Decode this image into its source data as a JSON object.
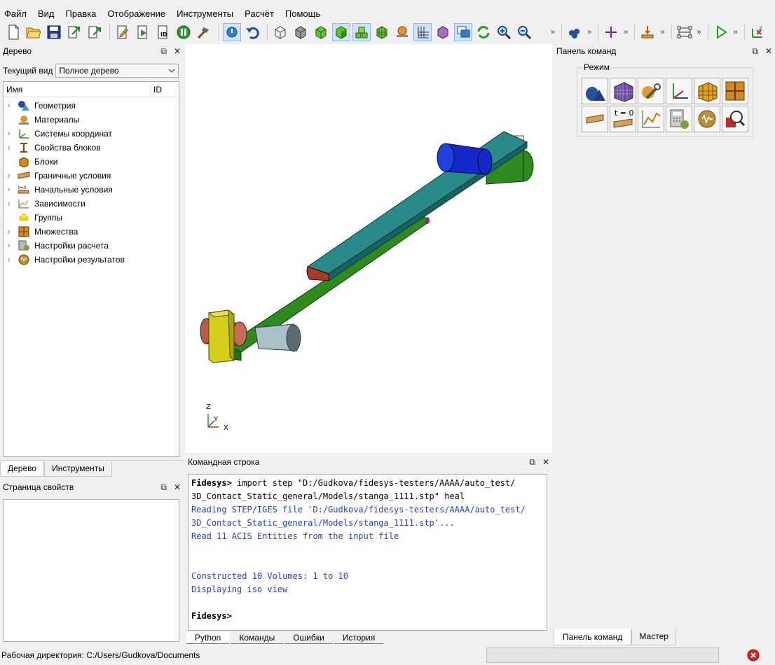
{
  "menu": [
    "Файл",
    "Вид",
    "Правка",
    "Отображение",
    "Инструменты",
    "Расчёт",
    "Помощь"
  ],
  "toolbar": {
    "more_label": "»"
  },
  "tree_panel": {
    "title": "Дерево",
    "float_icon": "⧉",
    "close_icon": "✕",
    "view_label": "Текущий вид",
    "view_value": "Полное дерево",
    "col_name": "Имя",
    "col_id": "ID",
    "items": [
      {
        "label": "Геометрия",
        "icon": "geometry-icon",
        "expandable": true
      },
      {
        "label": "Материалы",
        "icon": "materials-icon",
        "expandable": false
      },
      {
        "label": "Системы координат",
        "icon": "coordinate-systems-icon",
        "expandable": true
      },
      {
        "label": "Свойства блоков",
        "icon": "block-properties-icon",
        "expandable": true
      },
      {
        "label": "Блоки",
        "icon": "blocks-icon",
        "expandable": false
      },
      {
        "label": "Граничные условия",
        "icon": "boundary-conditions-icon",
        "expandable": true
      },
      {
        "label": "Начальные условия",
        "icon": "initial-conditions-icon",
        "expandable": true
      },
      {
        "label": "Зависимости",
        "icon": "dependencies-icon",
        "expandable": true
      },
      {
        "label": "Группы",
        "icon": "groups-icon",
        "expandable": false
      },
      {
        "label": "Множества",
        "icon": "sets-icon",
        "expandable": true
      },
      {
        "label": "Настройки расчета",
        "icon": "calc-settings-icon",
        "expandable": true
      },
      {
        "label": "Настройки результатов",
        "icon": "result-settings-icon",
        "expandable": true
      }
    ],
    "tabs": [
      "Дерево",
      "Инструменты"
    ]
  },
  "props_panel": {
    "title": "Страница свойств"
  },
  "viewport": {
    "axis_labels": {
      "z": "Z",
      "y": "Y",
      "x": "X"
    }
  },
  "command_panel": {
    "title": "Командная строка",
    "lines": [
      {
        "type": "cmd",
        "prompt": "Fidesys>",
        "text": " import step \"D:/Gudkova/fidesys-testers/AAAA/auto_test/"
      },
      {
        "type": "cmd-cont",
        "prompt": "",
        "text": "3D_Contact_Static_general/Models/stanga_1111.stp\" heal"
      },
      {
        "type": "out",
        "prompt": "",
        "text": "Reading STEP/IGES file 'D:/Gudkova/fidesys-testers/AAAA/auto_test/"
      },
      {
        "type": "out",
        "prompt": "",
        "text": "3D_Contact_Static_general/Models/stanga_1111.stp'..."
      },
      {
        "type": "out",
        "prompt": "",
        "text": "Read 11 ACIS Entities from the input file"
      },
      {
        "type": "blank",
        "prompt": "",
        "text": ""
      },
      {
        "type": "blank",
        "prompt": "",
        "text": ""
      },
      {
        "type": "out",
        "prompt": "",
        "text": "Constructed 10 Volumes: 1 to 10"
      },
      {
        "type": "out",
        "prompt": "",
        "text": "Displaying iso view"
      },
      {
        "type": "blank",
        "prompt": "",
        "text": ""
      },
      {
        "type": "cmd",
        "prompt": "Fidesys>",
        "text": ""
      }
    ],
    "tabs": [
      "Python",
      "Команды",
      "Ошибки",
      "История"
    ]
  },
  "right_panel": {
    "title": "Панель команд",
    "mode_label": "Режим",
    "tabs": [
      "Панель команд",
      "Мастер"
    ],
    "t0_label": "t = 0"
  },
  "status": {
    "text": "Рабочая директория: C:/Users/Gudkova/Documents"
  },
  "colors": {
    "output_blue": "#2a3fc8",
    "beam_teal": "#1f6f72",
    "beam_green": "#2f7f1e",
    "roller_blue": "#1428c8",
    "block_yellow": "#d4cf1a"
  }
}
